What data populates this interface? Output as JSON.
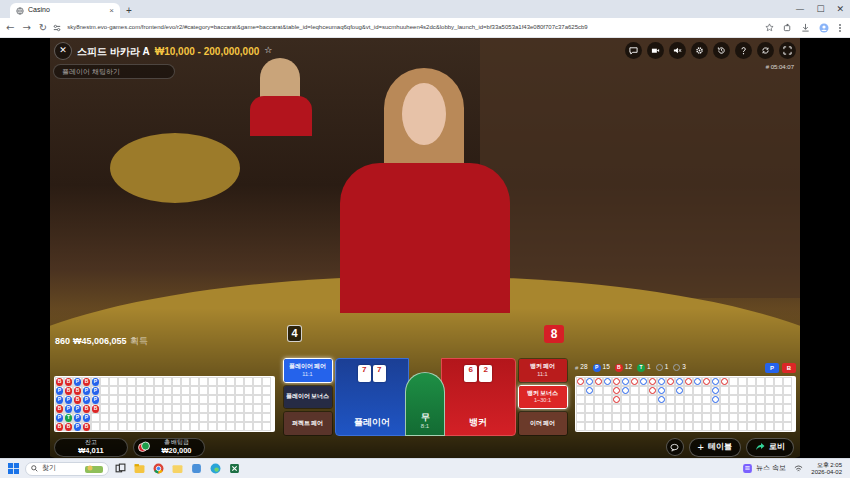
{
  "browser": {
    "tab": {
      "title": "Casino",
      "close": "×"
    },
    "new_tab": "+",
    "window_controls": [
      "—",
      "☐",
      "✕"
    ],
    "nav": [
      "←",
      "→",
      "↻"
    ],
    "url": "sky8nestm.evo-games.com/frontend/evo/r2/#category=baccarat&game=baccarat&table_id=leqhceumaq6qfoug&vt_id=sucmhuuheen4s2dc&lobby_launch_id=bf33a5053a1f43e080f707c37a625cb9"
  },
  "game": {
    "close": "✕",
    "title": "스피드 바카라 A",
    "limits": "₩10,000 - 200,000,000",
    "star": "☆",
    "chat": {
      "placeholder": "플레이어 채팅하기"
    },
    "round_id": "# 05:04:07",
    "player_score": "4",
    "banker_score": "8",
    "winners": {
      "count": "860",
      "amount": "₩45,006,055",
      "label": "획득"
    },
    "side_bets_left": [
      {
        "label": "플레이어 페어",
        "odds": "11:1",
        "color": "#2563eb",
        "highlighted": true
      },
      {
        "label": "플레이어 보너스",
        "color": "#262b45",
        "highlighted": false
      },
      {
        "label": "퍼펙트 페어",
        "color": "#5a342a",
        "highlighted": false
      }
    ],
    "player": {
      "label": "플레이어",
      "cards": [
        "7",
        "7"
      ]
    },
    "tie": {
      "label": "무",
      "odds": "8:1"
    },
    "banker": {
      "label": "뱅커",
      "cards": [
        "6",
        "2"
      ]
    },
    "side_bets_right": [
      {
        "label": "뱅커 페어",
        "odds": "11:1",
        "color": "#b91c1c",
        "highlighted": false
      },
      {
        "label": "뱅커 보너스",
        "odds": "1~30:1",
        "color": "#dc2626",
        "highlighted": true
      },
      {
        "label": "이더 페어",
        "color": "#6b3a2a",
        "highlighted": false
      }
    ],
    "stats": [
      {
        "kind": "text",
        "label": "#",
        "value": "28",
        "color": "#d1d5db"
      },
      {
        "kind": "badge",
        "label": "P",
        "value": "15",
        "color": "#2563eb"
      },
      {
        "kind": "badge",
        "label": "B",
        "value": "12",
        "color": "#dc2626"
      },
      {
        "kind": "badge",
        "label": "T",
        "value": "1",
        "color": "#16a34a"
      },
      {
        "kind": "dot",
        "value": "1",
        "color": "#9ca3af"
      },
      {
        "kind": "dot",
        "value": "3",
        "color": "#9ca3af"
      }
    ],
    "predict": [
      {
        "label": "P",
        "color": "#2563eb"
      },
      {
        "label": "B",
        "color": "#dc2626"
      }
    ],
    "bead_road": [
      {
        "r": "B",
        "color": "#dc2626"
      },
      {
        "r": "P",
        "color": "#2563eb"
      },
      {
        "r": "P",
        "color": "#2563eb"
      },
      {
        "r": "B",
        "color": "#dc2626"
      },
      {
        "r": "P",
        "color": "#2563eb"
      },
      {
        "r": "B",
        "color": "#dc2626"
      },
      {
        "r": "B",
        "color": "#dc2626"
      },
      {
        "r": "B",
        "color": "#dc2626"
      },
      {
        "r": "P",
        "color": "#2563eb"
      },
      {
        "r": "P",
        "color": "#2563eb"
      },
      {
        "r": "T",
        "color": "#16a34a"
      },
      {
        "r": "B",
        "color": "#dc2626"
      },
      {
        "r": "P",
        "color": "#2563eb"
      },
      {
        "r": "B",
        "color": "#dc2626"
      },
      {
        "r": "B",
        "color": "#dc2626"
      },
      {
        "r": "P",
        "color": "#2563eb"
      },
      {
        "r": "P",
        "color": "#2563eb"
      },
      {
        "r": "P",
        "color": "#2563eb"
      },
      {
        "r": "B",
        "color": "#dc2626"
      },
      {
        "r": "P",
        "color": "#2563eb"
      },
      {
        "r": "P",
        "color": "#2563eb"
      },
      {
        "r": "B",
        "color": "#dc2626"
      },
      {
        "r": "P",
        "color": "#2563eb"
      },
      {
        "r": "B",
        "color": "#dc2626"
      },
      {
        "r": "P",
        "color": "#2563eb"
      },
      {
        "r": "P",
        "color": "#2563eb"
      },
      {
        "r": "P",
        "color": "#2563eb"
      },
      {
        "r": "B",
        "color": "#dc2626"
      }
    ],
    "big_road": [
      {
        "color": "#dc2626",
        "count": 1
      },
      {
        "color": "#2563eb",
        "count": 2
      },
      {
        "color": "#dc2626",
        "count": 1
      },
      {
        "color": "#2563eb",
        "count": 1
      },
      {
        "color": "#dc2626",
        "count": 3
      },
      {
        "color": "#2563eb",
        "count": 2
      },
      {
        "color": "#dc2626",
        "count": 1
      },
      {
        "color": "#2563eb",
        "count": 1
      },
      {
        "color": "#dc2626",
        "count": 2
      },
      {
        "color": "#2563eb",
        "count": 3
      },
      {
        "color": "#dc2626",
        "count": 1
      },
      {
        "color": "#2563eb",
        "count": 2
      },
      {
        "color": "#dc2626",
        "count": 1
      },
      {
        "color": "#2563eb",
        "count": 1
      },
      {
        "color": "#dc2626",
        "count": 1
      },
      {
        "color": "#2563eb",
        "count": 3
      },
      {
        "color": "#dc2626",
        "count": 1
      }
    ],
    "balance": {
      "label": "잔고",
      "value": "₩4,011"
    },
    "total_bet": {
      "label": "총 배팅금",
      "value": "₩20,000"
    },
    "table_button": {
      "icon": "+",
      "label": "테이블"
    },
    "lobby_button": {
      "label": "로비"
    }
  },
  "taskbar": {
    "search": "찾기",
    "news": "뉴스 속보",
    "time": "오후 2:05",
    "date": "2026-04-02"
  }
}
